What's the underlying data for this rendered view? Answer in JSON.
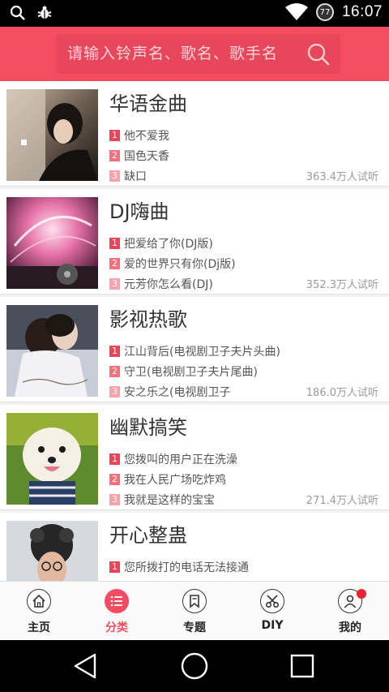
{
  "status_bar": {
    "left_icons": [
      "search-icon",
      "bug-icon"
    ],
    "battery_level": "77",
    "time": "16:07"
  },
  "search": {
    "placeholder": "请输入铃声名、歌名、歌手名"
  },
  "categories": [
    {
      "title": "华语金曲",
      "songs": [
        "他不爱我",
        "国色天香",
        "缺口"
      ],
      "listeners": "363.4万人试听"
    },
    {
      "title": "DJ嗨曲",
      "songs": [
        "把爱给了你(DJ版)",
        "爱的世界只有你(Dj版)",
        "元芳你怎么看(DJ)"
      ],
      "listeners": "352.3万人试听"
    },
    {
      "title": "影视热歌",
      "songs": [
        "江山背后(电视剧卫子夫片头曲)",
        "守卫(电视剧卫子夫片尾曲)",
        "安之乐之(电视剧卫子"
      ],
      "listeners": "186.0万人试听"
    },
    {
      "title": "幽默搞笑",
      "songs": [
        "您拨叫的用户正在洗澡",
        "我在人民广场吃炸鸡",
        "我就是这样的宝宝"
      ],
      "listeners": "271.4万人试听"
    },
    {
      "title": "开心整蛊",
      "songs": [
        "您所拨打的电话无法接通"
      ],
      "listeners": ""
    }
  ],
  "bottom_nav": [
    {
      "label": "主页",
      "icon": "home-icon",
      "active": false
    },
    {
      "label": "分类",
      "icon": "list-icon",
      "active": true
    },
    {
      "label": "专题",
      "icon": "bookmark-icon",
      "active": false
    },
    {
      "label": "DIY",
      "icon": "scissors-icon",
      "active": false
    },
    {
      "label": "我的",
      "icon": "user-icon",
      "active": false
    }
  ],
  "colors": {
    "accent": "#f44d61",
    "header_bg": "#f44d61"
  }
}
